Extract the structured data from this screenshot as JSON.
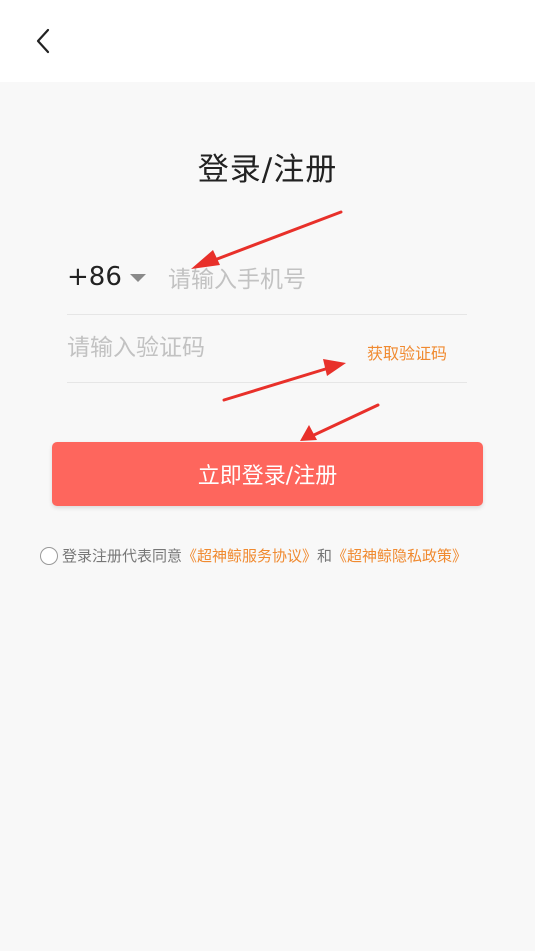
{
  "header": {
    "back_icon": "chevron-left-icon"
  },
  "page": {
    "title": "登录/注册"
  },
  "phone": {
    "country_code": "+86",
    "placeholder": "请输入手机号"
  },
  "code": {
    "placeholder": "请输入验证码",
    "get_code_label": "获取验证码"
  },
  "submit": {
    "label": "立即登录/注册"
  },
  "agreement": {
    "prefix": "登录注册代表同意",
    "service_link": "《超神鲸服务协议》",
    "and": "和",
    "privacy_link": "《超神鲸隐私政策》"
  },
  "colors": {
    "accent": "#fe665d",
    "link": "#f08a30",
    "annotation_arrow": "#e8302a"
  }
}
